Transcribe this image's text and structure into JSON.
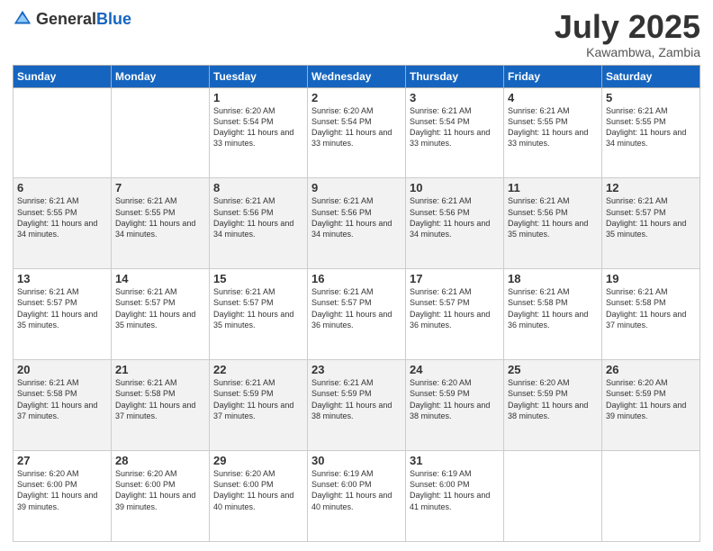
{
  "logo": {
    "general": "General",
    "blue": "Blue"
  },
  "header": {
    "month": "July 2025",
    "location": "Kawambwa, Zambia"
  },
  "weekdays": [
    "Sunday",
    "Monday",
    "Tuesday",
    "Wednesday",
    "Thursday",
    "Friday",
    "Saturday"
  ],
  "weeks": [
    [
      {
        "day": "",
        "info": ""
      },
      {
        "day": "",
        "info": ""
      },
      {
        "day": "1",
        "info": "Sunrise: 6:20 AM\nSunset: 5:54 PM\nDaylight: 11 hours and 33 minutes."
      },
      {
        "day": "2",
        "info": "Sunrise: 6:20 AM\nSunset: 5:54 PM\nDaylight: 11 hours and 33 minutes."
      },
      {
        "day": "3",
        "info": "Sunrise: 6:21 AM\nSunset: 5:54 PM\nDaylight: 11 hours and 33 minutes."
      },
      {
        "day": "4",
        "info": "Sunrise: 6:21 AM\nSunset: 5:55 PM\nDaylight: 11 hours and 33 minutes."
      },
      {
        "day": "5",
        "info": "Sunrise: 6:21 AM\nSunset: 5:55 PM\nDaylight: 11 hours and 34 minutes."
      }
    ],
    [
      {
        "day": "6",
        "info": "Sunrise: 6:21 AM\nSunset: 5:55 PM\nDaylight: 11 hours and 34 minutes."
      },
      {
        "day": "7",
        "info": "Sunrise: 6:21 AM\nSunset: 5:55 PM\nDaylight: 11 hours and 34 minutes."
      },
      {
        "day": "8",
        "info": "Sunrise: 6:21 AM\nSunset: 5:56 PM\nDaylight: 11 hours and 34 minutes."
      },
      {
        "day": "9",
        "info": "Sunrise: 6:21 AM\nSunset: 5:56 PM\nDaylight: 11 hours and 34 minutes."
      },
      {
        "day": "10",
        "info": "Sunrise: 6:21 AM\nSunset: 5:56 PM\nDaylight: 11 hours and 34 minutes."
      },
      {
        "day": "11",
        "info": "Sunrise: 6:21 AM\nSunset: 5:56 PM\nDaylight: 11 hours and 35 minutes."
      },
      {
        "day": "12",
        "info": "Sunrise: 6:21 AM\nSunset: 5:57 PM\nDaylight: 11 hours and 35 minutes."
      }
    ],
    [
      {
        "day": "13",
        "info": "Sunrise: 6:21 AM\nSunset: 5:57 PM\nDaylight: 11 hours and 35 minutes."
      },
      {
        "day": "14",
        "info": "Sunrise: 6:21 AM\nSunset: 5:57 PM\nDaylight: 11 hours and 35 minutes."
      },
      {
        "day": "15",
        "info": "Sunrise: 6:21 AM\nSunset: 5:57 PM\nDaylight: 11 hours and 35 minutes."
      },
      {
        "day": "16",
        "info": "Sunrise: 6:21 AM\nSunset: 5:57 PM\nDaylight: 11 hours and 36 minutes."
      },
      {
        "day": "17",
        "info": "Sunrise: 6:21 AM\nSunset: 5:57 PM\nDaylight: 11 hours and 36 minutes."
      },
      {
        "day": "18",
        "info": "Sunrise: 6:21 AM\nSunset: 5:58 PM\nDaylight: 11 hours and 36 minutes."
      },
      {
        "day": "19",
        "info": "Sunrise: 6:21 AM\nSunset: 5:58 PM\nDaylight: 11 hours and 37 minutes."
      }
    ],
    [
      {
        "day": "20",
        "info": "Sunrise: 6:21 AM\nSunset: 5:58 PM\nDaylight: 11 hours and 37 minutes."
      },
      {
        "day": "21",
        "info": "Sunrise: 6:21 AM\nSunset: 5:58 PM\nDaylight: 11 hours and 37 minutes."
      },
      {
        "day": "22",
        "info": "Sunrise: 6:21 AM\nSunset: 5:59 PM\nDaylight: 11 hours and 37 minutes."
      },
      {
        "day": "23",
        "info": "Sunrise: 6:21 AM\nSunset: 5:59 PM\nDaylight: 11 hours and 38 minutes."
      },
      {
        "day": "24",
        "info": "Sunrise: 6:20 AM\nSunset: 5:59 PM\nDaylight: 11 hours and 38 minutes."
      },
      {
        "day": "25",
        "info": "Sunrise: 6:20 AM\nSunset: 5:59 PM\nDaylight: 11 hours and 38 minutes."
      },
      {
        "day": "26",
        "info": "Sunrise: 6:20 AM\nSunset: 5:59 PM\nDaylight: 11 hours and 39 minutes."
      }
    ],
    [
      {
        "day": "27",
        "info": "Sunrise: 6:20 AM\nSunset: 6:00 PM\nDaylight: 11 hours and 39 minutes."
      },
      {
        "day": "28",
        "info": "Sunrise: 6:20 AM\nSunset: 6:00 PM\nDaylight: 11 hours and 39 minutes."
      },
      {
        "day": "29",
        "info": "Sunrise: 6:20 AM\nSunset: 6:00 PM\nDaylight: 11 hours and 40 minutes."
      },
      {
        "day": "30",
        "info": "Sunrise: 6:19 AM\nSunset: 6:00 PM\nDaylight: 11 hours and 40 minutes."
      },
      {
        "day": "31",
        "info": "Sunrise: 6:19 AM\nSunset: 6:00 PM\nDaylight: 11 hours and 41 minutes."
      },
      {
        "day": "",
        "info": ""
      },
      {
        "day": "",
        "info": ""
      }
    ]
  ]
}
